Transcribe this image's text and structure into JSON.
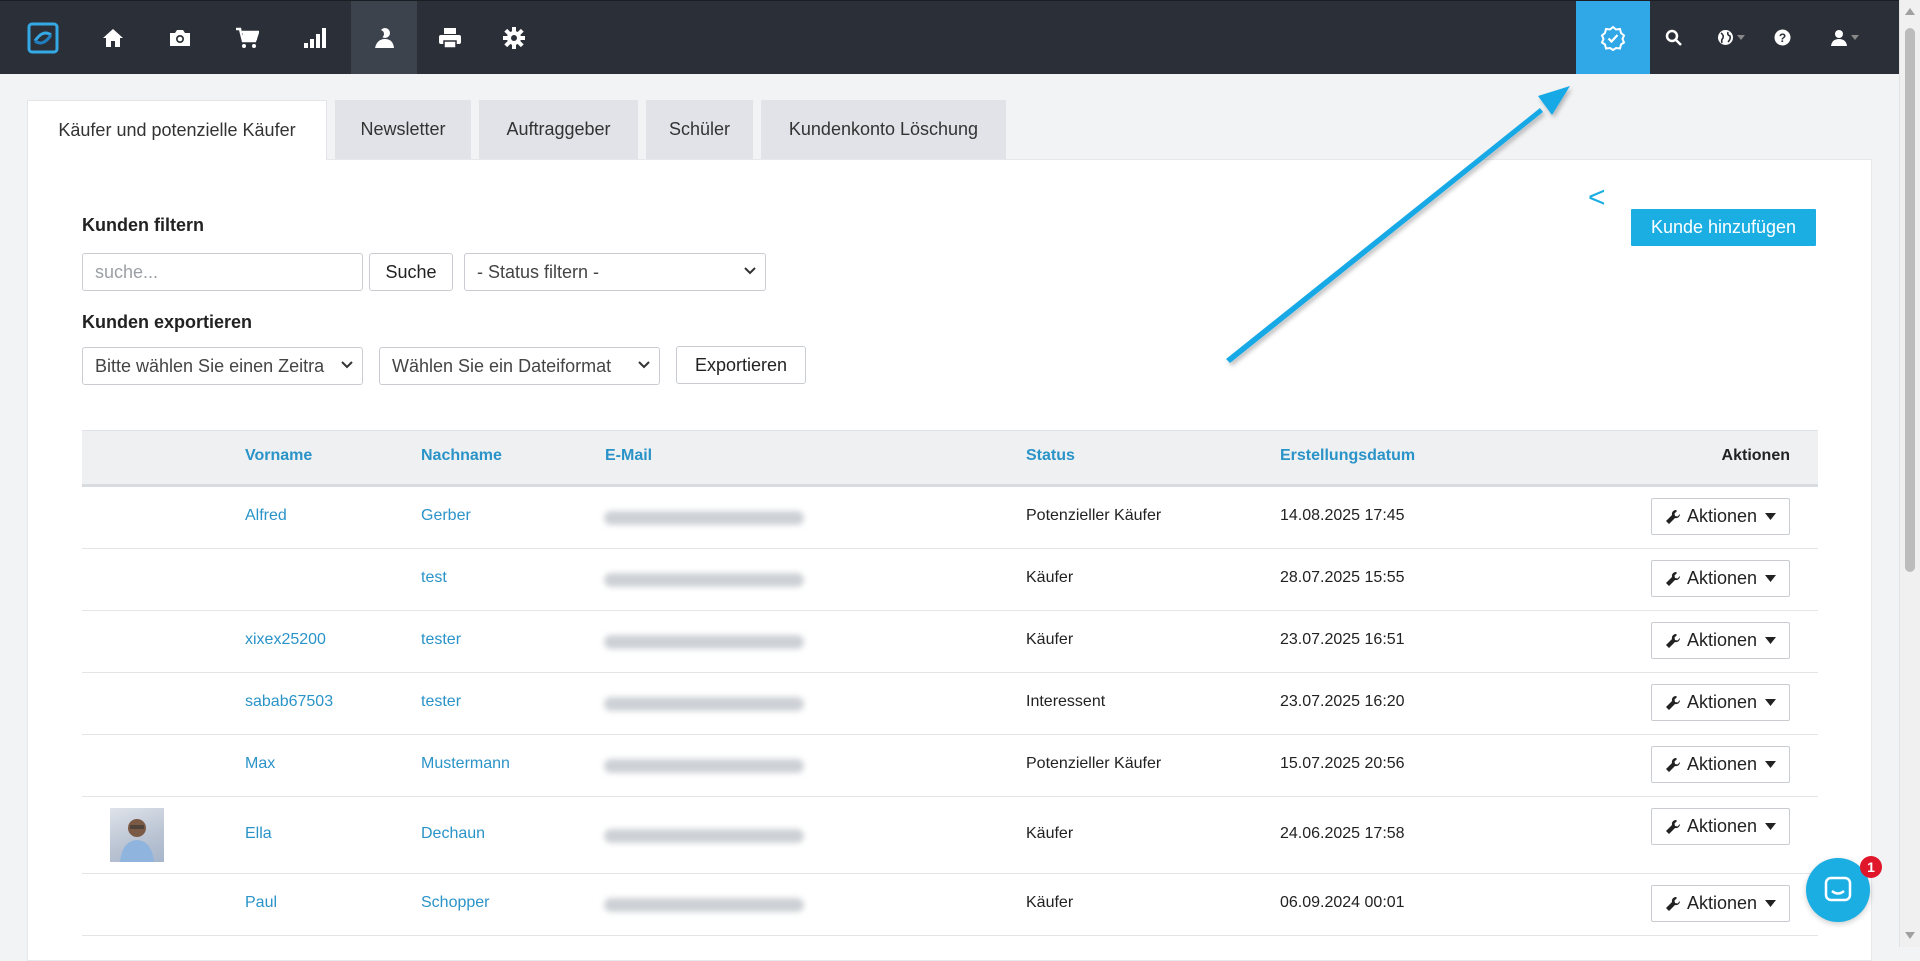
{
  "navbar": {
    "items": [
      {
        "icon": "logo-icon"
      },
      {
        "icon": "home-icon"
      },
      {
        "icon": "camera-icon"
      },
      {
        "icon": "cart-icon"
      },
      {
        "icon": "stats-icon"
      },
      {
        "icon": "customers-icon",
        "active": true
      },
      {
        "icon": "print-icon"
      },
      {
        "icon": "settings-icon"
      }
    ],
    "right": [
      {
        "icon": "badge-check-icon",
        "highlight": true
      },
      {
        "icon": "search-icon"
      },
      {
        "icon": "globe-icon"
      },
      {
        "icon": "help-icon"
      },
      {
        "icon": "user-icon"
      }
    ],
    "highlight_color": "#30a8e8"
  },
  "tabs": [
    {
      "label": "Käufer und potenzielle Käufer",
      "active": true
    },
    {
      "label": "Newsletter"
    },
    {
      "label": "Auftraggeber"
    },
    {
      "label": "Schüler"
    },
    {
      "label": "Kundenkonto Löschung"
    }
  ],
  "filter": {
    "title": "Kunden filtern",
    "search_placeholder": "suche...",
    "search_button": "Suche",
    "status_select": "- Status filtern -"
  },
  "export": {
    "title": "Kunden exportieren",
    "period_select": "Bitte wählen Sie einen Zeitra",
    "format_select": "Wählen Sie ein Dateiformat",
    "export_button": "Exportieren"
  },
  "add_customer_button": "Kunde hinzufügen",
  "back_arrow": "<",
  "table": {
    "headers": {
      "first_name": "Vorname",
      "last_name": "Nachname",
      "email": "E-Mail",
      "status": "Status",
      "created": "Erstellungsdatum",
      "actions": "Aktionen"
    },
    "action_label": "Aktionen",
    "rows": [
      {
        "first_name": "Alfred",
        "last_name": "Gerber",
        "status": "Potenzieller Käufer",
        "created": "14.08.2025 17:45"
      },
      {
        "first_name": "",
        "last_name": "test",
        "status": "Käufer",
        "created": "28.07.2025 15:55"
      },
      {
        "first_name": "xixex25200",
        "last_name": "tester",
        "status": "Käufer",
        "created": "23.07.2025 16:51"
      },
      {
        "first_name": "sabab67503",
        "last_name": "tester",
        "status": "Interessent",
        "created": "23.07.2025 16:20"
      },
      {
        "first_name": "Max",
        "last_name": "Mustermann",
        "status": "Potenzieller Käufer",
        "created": "15.07.2025 20:56"
      },
      {
        "first_name": "Ella",
        "last_name": "Dechaun",
        "status": "Käufer",
        "created": "24.06.2025 17:58",
        "has_photo": true
      },
      {
        "first_name": "Paul",
        "last_name": "Schopper",
        "status": "Käufer",
        "created": "06.09.2024 00:01"
      }
    ]
  },
  "chat": {
    "badge_count": "1"
  },
  "colors": {
    "accent": "#1aaee3",
    "link": "#2a93c8",
    "navbar": "#2b2f37",
    "badge": "#e0162b"
  }
}
